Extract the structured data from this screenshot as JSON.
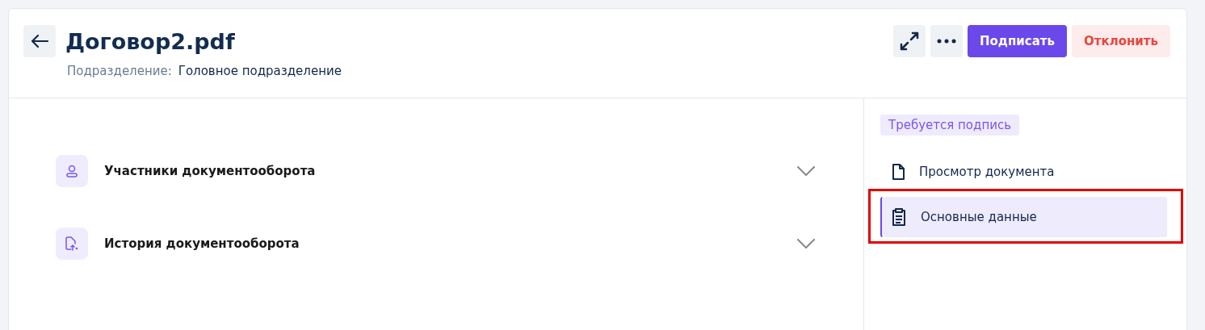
{
  "header": {
    "title": "Договор2.pdf",
    "subtitle_label": "Подразделение:",
    "subtitle_value": "Головное подразделение",
    "actions": [
      {
        "kind": "expand"
      },
      {
        "kind": "more"
      },
      {
        "kind": "primary",
        "label": "Подписать"
      },
      {
        "kind": "danger",
        "label": "Отклонить"
      }
    ]
  },
  "sections": [
    {
      "kind": "participants",
      "title": "Участники документооборота",
      "expanded": false
    },
    {
      "kind": "history",
      "title": "История документооборота",
      "expanded": false
    }
  ],
  "sidebar": {
    "status": "Требуется подпись",
    "items": [
      {
        "kind": "document",
        "label": "Просмотр документа",
        "selected": false,
        "highlighted": false
      },
      {
        "kind": "clipboard",
        "label": "Основные данные",
        "selected": true,
        "highlighted": true
      }
    ]
  }
}
